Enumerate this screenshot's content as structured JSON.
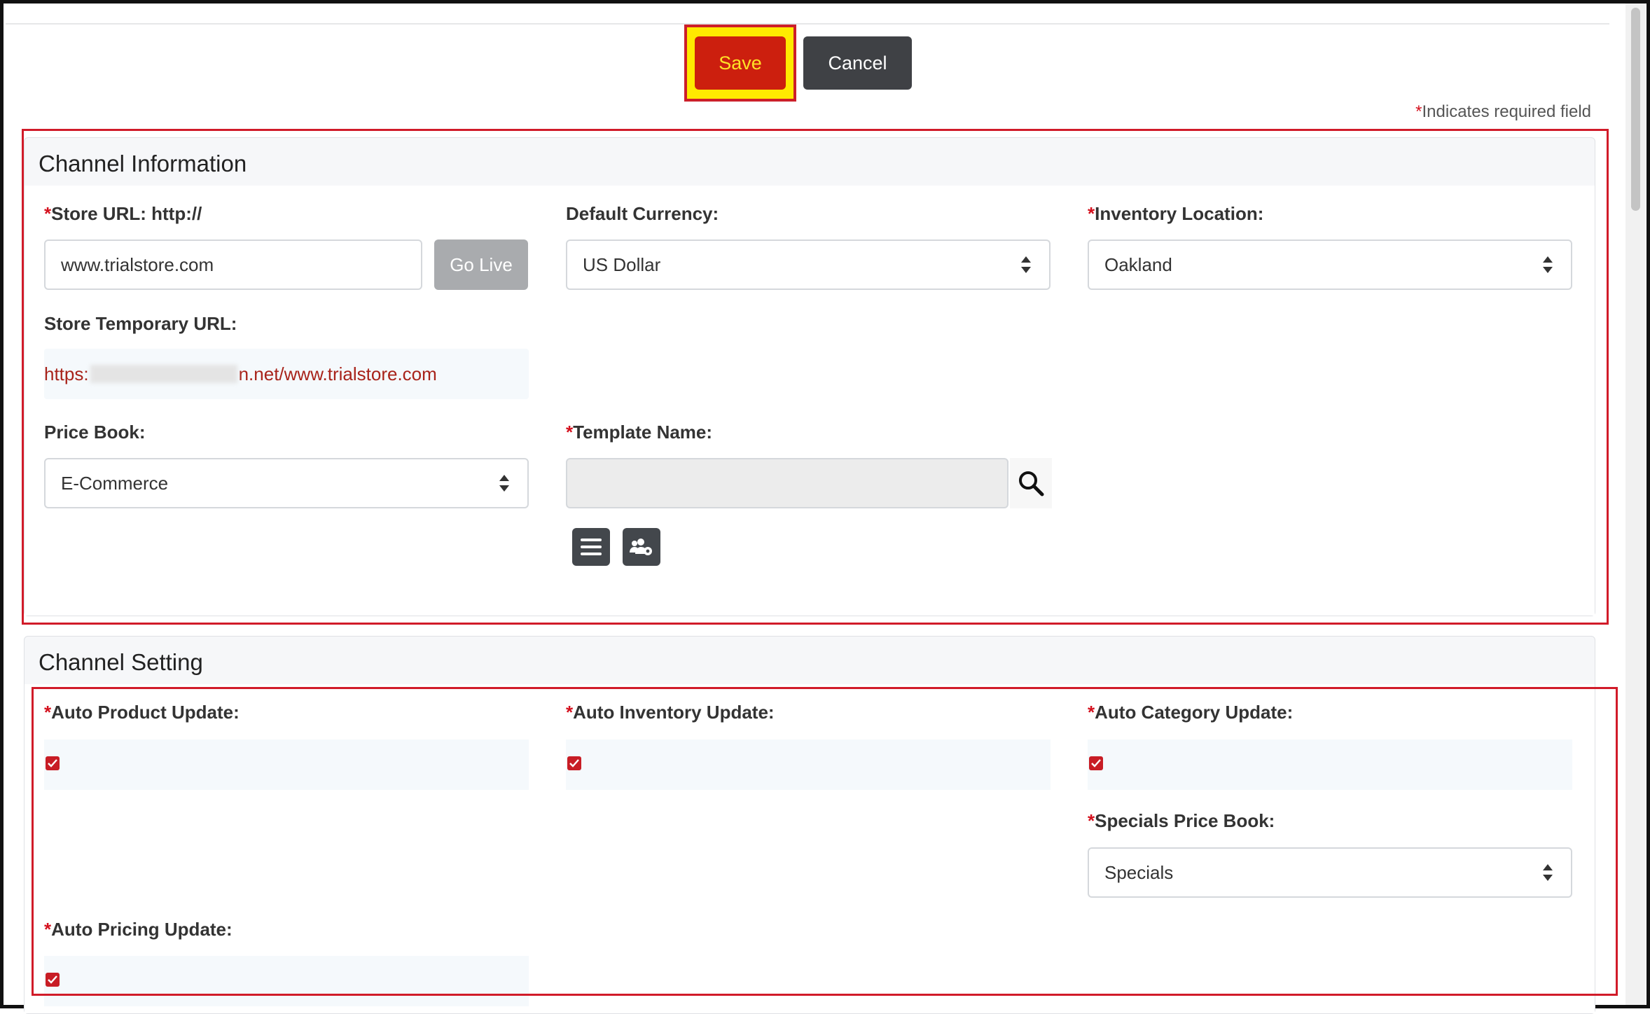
{
  "toolbar": {
    "save_label": "Save",
    "cancel_label": "Cancel"
  },
  "required_note": {
    "star": "*",
    "text": "Indicates required field"
  },
  "channel_information": {
    "title": "Channel Information",
    "store_url": {
      "star": "*",
      "label": "Store URL: http://",
      "value": "www.trialstore.com",
      "go_live_label": "Go Live"
    },
    "default_currency": {
      "label": "Default Currency:",
      "value": "US Dollar"
    },
    "inventory_location": {
      "star": "*",
      "label": "Inventory Location:",
      "value": "Oakland"
    },
    "store_temporary_url": {
      "label": "Store Temporary URL:",
      "prefix": "https:",
      "suffix": "n.net/www.trialstore.com"
    },
    "price_book": {
      "label": "Price Book:",
      "value": "E-Commerce"
    },
    "template_name": {
      "star": "*",
      "label": "Template Name:",
      "value": ""
    }
  },
  "channel_setting": {
    "title": "Channel Setting",
    "auto_product_update": {
      "star": "*",
      "label": "Auto Product Update:",
      "checked": true
    },
    "auto_inventory_update": {
      "star": "*",
      "label": "Auto Inventory Update:",
      "checked": true
    },
    "auto_category_update": {
      "star": "*",
      "label": "Auto Category Update:",
      "checked": true
    },
    "specials_price_book": {
      "star": "*",
      "label": "Specials Price Book:",
      "value": "Specials"
    },
    "auto_pricing_update": {
      "star": "*",
      "label": "Auto Pricing Update:",
      "checked": true
    }
  },
  "icons": [
    "search-icon",
    "list-icon",
    "users-gear-icon",
    "check-icon",
    "select-arrows-icon"
  ],
  "colors": {
    "save_bg": "#cc1f0e",
    "save_text": "#ffe227",
    "highlight": "#ffea00",
    "annotation_red": "#d11b29",
    "cancel_bg": "#3f4145",
    "required_star": "#d4111e"
  }
}
